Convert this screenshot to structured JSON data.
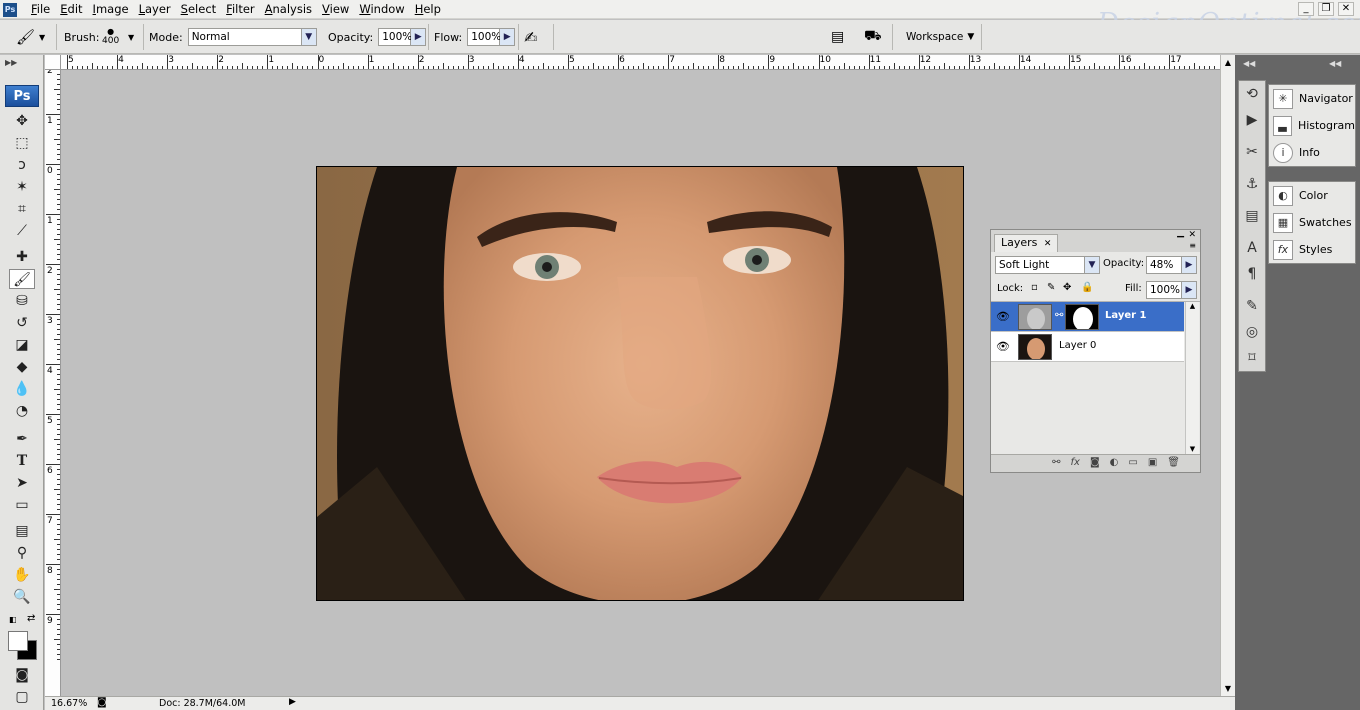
{
  "app": {
    "logo": "Ps"
  },
  "menu": [
    "File",
    "Edit",
    "Image",
    "Layer",
    "Select",
    "Filter",
    "Analysis",
    "View",
    "Window",
    "Help"
  ],
  "watermark": "DesignOptimal.com",
  "options": {
    "brush_label": "Brush:",
    "brush_size": "400",
    "mode_label": "Mode:",
    "mode_value": "Normal",
    "opacity_label": "Opacity:",
    "opacity_value": "100%",
    "flow_label": "Flow:",
    "flow_value": "100%",
    "workspace_label": "Workspace"
  },
  "rulers": {
    "top": [
      "5",
      "4",
      "3",
      "2",
      "1",
      "0",
      "1",
      "2",
      "3",
      "4",
      "5",
      "6",
      "7",
      "8",
      "9",
      "10",
      "11",
      "12",
      "13",
      "14",
      "15",
      "16",
      "17"
    ],
    "left": [
      "2",
      "1",
      "0",
      "1",
      "2",
      "3",
      "4",
      "5",
      "6",
      "7",
      "8",
      "9"
    ]
  },
  "status": {
    "zoom": "16.67%",
    "doc": "Doc: 28.7M/64.0M"
  },
  "panels": {
    "group1": [
      {
        "label": "Navigator",
        "icon": "navigator-icon"
      },
      {
        "label": "Histogram",
        "icon": "histogram-icon"
      },
      {
        "label": "Info",
        "icon": "info-icon"
      }
    ],
    "group2": [
      {
        "label": "Color",
        "icon": "color-icon"
      },
      {
        "label": "Swatches",
        "icon": "swatches-icon"
      },
      {
        "label": "Styles",
        "icon": "styles-icon"
      }
    ]
  },
  "layers_panel": {
    "tab": "Layers",
    "blend_mode": "Soft Light",
    "opacity_label": "Opacity:",
    "opacity_value": "48%",
    "lock_label": "Lock:",
    "fill_label": "Fill:",
    "fill_value": "100%",
    "layers": [
      {
        "name": "Layer 1",
        "selected": true
      },
      {
        "name": "Layer 0",
        "selected": false
      }
    ]
  },
  "colors": {
    "accent": "#3a6ec8",
    "canvas": "#c0c0c0",
    "dock": "#666666"
  }
}
